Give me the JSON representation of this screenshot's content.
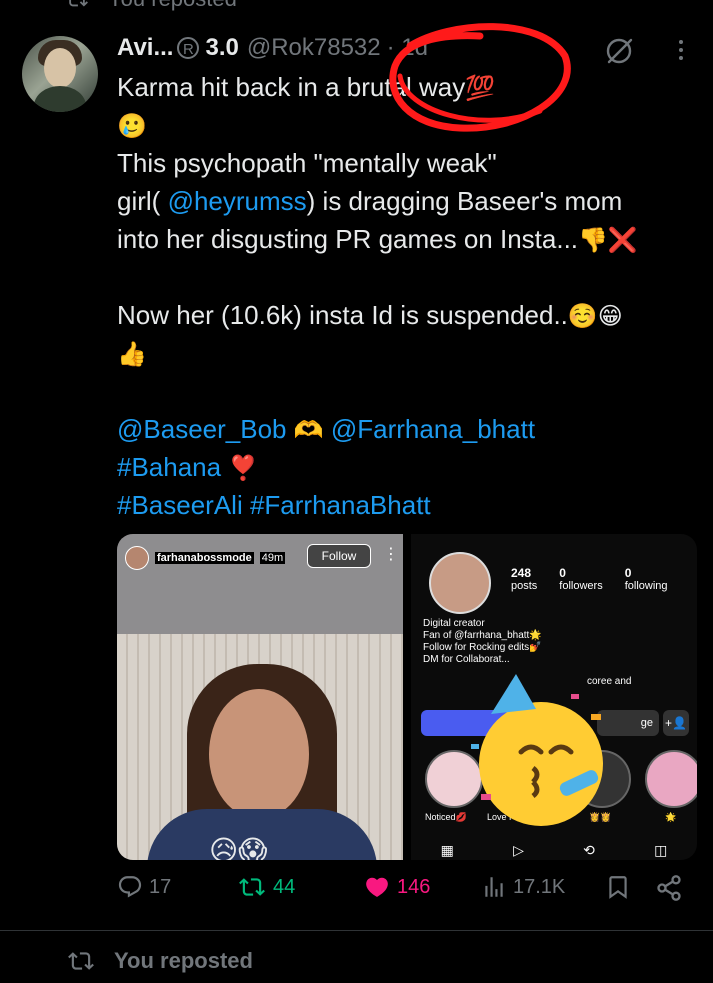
{
  "top_context": {
    "label": "You reposted"
  },
  "tweet": {
    "author_name": "Avi...",
    "author_version": "3.0",
    "author_handle": "@Rok78532",
    "time": "· 1d",
    "lines": {
      "l1_text": "Karma hit back in a brutal way",
      "l1_emoji": "💯",
      "l2_emoji": "🥲",
      "l3": "This psychopath \"mentally weak\"",
      "l4_pre": "girl( ",
      "l4_link": "@heyrumss",
      "l4_post": ") is dragging Baseer's mom",
      "l5_text": "into her disgusting PR games on Insta...",
      "l5_emoji1": "👎",
      "l5_emoji2": "❌",
      "l6_text": "Now her (10.6k) insta Id is suspended..",
      "l6_emoji": "☺️😁",
      "l7_emoji": "👍",
      "mention1": "@Baseer_Bob",
      "heart_hands": "🫶",
      "mention2": "@Farrhana_bhatt",
      "hashtag1": "#Bahana",
      "heart_exclaim": "❣️",
      "hashtag2": "#BaseerAli",
      "hashtag3": "#FarrhanaBhatt"
    }
  },
  "media": {
    "left": {
      "username": "farhanabossmode",
      "time": "49m",
      "follow": "Follow",
      "emojis": "😥😱"
    },
    "right": {
      "stats": [
        {
          "value": "248",
          "label": "posts"
        },
        {
          "value": "0",
          "label": "followers"
        },
        {
          "value": "0",
          "label": "following"
        }
      ],
      "bio": [
        "Digital creator",
        "Fan of @farrhana_bhatt🌟",
        "Follow for Rocking edits💅",
        "DM for Collaborat..."
      ],
      "mutual_text": "coree and",
      "message_label": "ge",
      "highlights": [
        "Noticed💋",
        "Love From Fa...",
        "👸👸",
        "",
        "🌟"
      ],
      "sticker": "🥳"
    }
  },
  "actions": {
    "replies": "17",
    "reposts": "44",
    "likes": "146",
    "views": "17.1K"
  },
  "colors": {
    "accent": "#1d9bf0",
    "repost_green": "#00ba7c",
    "like_pink": "#f91880",
    "muted": "#71767b",
    "annotation_red": "#ff1a1a"
  },
  "bottom_context": {
    "label": "You reposted"
  }
}
